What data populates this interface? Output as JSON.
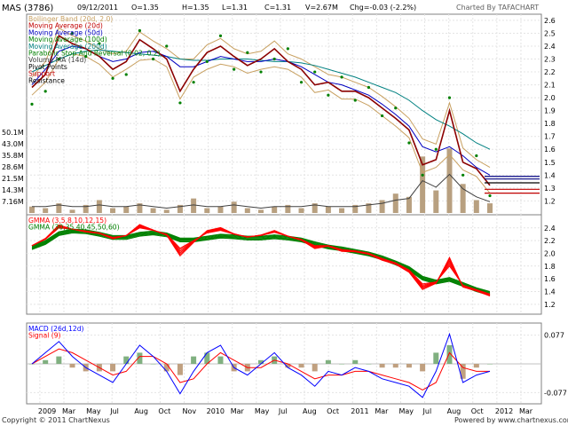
{
  "header": {
    "symbol": "MAS (3786)",
    "date": "09/12/2011",
    "open": "O=1.35",
    "high": "H=1.35",
    "low": "L=1.31",
    "close": "C=1.31",
    "volume": "V=2.67M",
    "change": "Chg=-0.03 (-2.2%)",
    "charted_by": "Charted By TAFACHART"
  },
  "footer": {
    "copyright": "Copyright © 2011 ChartNexus",
    "powered_by": "Powered by www.chartnexus.com"
  },
  "colors": {
    "price": "#8b0000",
    "bollinger": "#c8a060",
    "ma20": "#c00000",
    "ma50": "#0000c0",
    "ma100": "#008000",
    "ma200": "#008080",
    "psar": "#008000",
    "volume": "#b8a080",
    "volume_ma": "#404040",
    "gmma_short": "#ff0000",
    "gmma_long": "#008000",
    "macd": "#0000ff",
    "signal": "#ff0000",
    "hist_pos": "#80b080",
    "hist_neg": "#c0a080"
  },
  "chart_data": [
    {
      "type": "line",
      "title": "MAS (3786)",
      "legend": [
        {
          "label": "Bollinger Band (20d, 2.0)",
          "color": "#c8a060"
        },
        {
          "label": "Moving Average (20d)",
          "color": "#c00000"
        },
        {
          "label": "Moving Average (50d)",
          "color": "#0000c0"
        },
        {
          "label": "Moving Average (100d)",
          "color": "#008000"
        },
        {
          "label": "Moving Average (200d)",
          "color": "#008080"
        },
        {
          "label": "Parabolic Stop And Reversal (0.02, 0.2)",
          "color": "#008000"
        },
        {
          "label": "Volume MA (14d)",
          "color": "#404040"
        },
        {
          "label": "Pivot Points",
          "color": "#000000"
        },
        {
          "label": "Support",
          "color": "#c00000"
        },
        {
          "label": "Resistance",
          "color": "#000000"
        }
      ],
      "legend_position": "top-left",
      "x_labels": [
        "2009",
        "Mar",
        "May",
        "Jul",
        "Aug",
        "Oct",
        "Nov",
        "2010",
        "Mar",
        "May",
        "Jul",
        "Aug",
        "Oct",
        "2011",
        "Mar",
        "May",
        "Jul",
        "Aug",
        "Oct",
        "2012",
        "Mar"
      ],
      "y_ticks": [
        1.2,
        1.3,
        1.4,
        1.5,
        1.6,
        1.7,
        1.8,
        1.9,
        2.0,
        2.1,
        2.2,
        2.3,
        2.4,
        2.5,
        2.6
      ],
      "y_tick_labels": [
        "1.2",
        "1.3",
        "1.4",
        "1.5",
        "1.6",
        "1.7",
        "1.8",
        "1.9",
        "2.0",
        "2.1",
        "2.2",
        "2.3",
        "2.4",
        "2.5",
        "2.6"
      ],
      "ylim": [
        1.12,
        2.62
      ],
      "volume_ticks": [
        7.16,
        14.3,
        21.5,
        28.6,
        35.8,
        43.0,
        50.1
      ],
      "volume_tick_labels": [
        "7.16M",
        "14.3M",
        "21.5M",
        "28.6M",
        "35.8M",
        "43.0M",
        "50.1M"
      ],
      "volume_lim": [
        0,
        55
      ],
      "pivot_levels": [
        1.34,
        1.37,
        1.39,
        1.29,
        1.26
      ],
      "months": [
        1,
        2,
        3,
        4,
        5,
        6,
        7,
        8,
        9,
        10,
        11,
        12,
        13,
        14,
        15,
        16,
        17,
        18,
        19,
        20,
        21,
        22,
        23,
        24,
        25,
        26,
        27,
        28,
        29,
        30,
        31,
        32,
        33,
        34,
        35
      ],
      "price": [
        2.08,
        2.18,
        2.48,
        2.42,
        2.38,
        2.32,
        2.22,
        2.28,
        2.45,
        2.38,
        2.3,
        2.05,
        2.22,
        2.35,
        2.4,
        2.32,
        2.25,
        2.3,
        2.38,
        2.28,
        2.22,
        2.1,
        2.12,
        2.05,
        2.05,
        2.0,
        1.92,
        1.84,
        1.75,
        1.48,
        1.52,
        1.9,
        1.5,
        1.45,
        1.32
      ],
      "ma50": [
        2.1,
        2.22,
        2.36,
        2.4,
        2.38,
        2.32,
        2.28,
        2.3,
        2.35,
        2.36,
        2.32,
        2.24,
        2.24,
        2.28,
        2.32,
        2.3,
        2.28,
        2.28,
        2.3,
        2.28,
        2.24,
        2.18,
        2.12,
        2.1,
        2.06,
        2.02,
        1.95,
        1.87,
        1.78,
        1.62,
        1.58,
        1.62,
        1.55,
        1.46,
        1.4
      ],
      "ma200": [
        2.2,
        2.25,
        2.3,
        2.34,
        2.36,
        2.37,
        2.36,
        2.35,
        2.34,
        2.33,
        2.32,
        2.3,
        2.29,
        2.29,
        2.3,
        2.3,
        2.3,
        2.29,
        2.28,
        2.28,
        2.27,
        2.25,
        2.22,
        2.19,
        2.16,
        2.12,
        2.08,
        2.04,
        1.98,
        1.9,
        1.83,
        1.78,
        1.72,
        1.65,
        1.6
      ],
      "psar": [
        1.95,
        2.05,
        2.3,
        2.5,
        2.32,
        2.42,
        2.15,
        2.18,
        2.52,
        2.3,
        2.4,
        1.96,
        2.12,
        2.28,
        2.48,
        2.22,
        2.35,
        2.2,
        2.3,
        2.38,
        2.12,
        2.2,
        2.02,
        2.16,
        1.98,
        2.08,
        1.86,
        1.92,
        1.65,
        1.4,
        1.6,
        2.0,
        1.4,
        1.55,
        1.24
      ],
      "volume": [
        4,
        3,
        6,
        2,
        5,
        8,
        3,
        4,
        6,
        3,
        2,
        5,
        9,
        3,
        4,
        7,
        3,
        2,
        4,
        5,
        3,
        6,
        4,
        3,
        5,
        6,
        8,
        12,
        10,
        35,
        14,
        40,
        18,
        8,
        6
      ],
      "volume_ma": [
        4,
        4,
        5,
        4,
        4,
        5,
        4,
        4,
        5,
        4,
        3,
        4,
        5,
        4,
        4,
        5,
        4,
        3,
        4,
        4,
        4,
        5,
        4,
        4,
        4,
        5,
        6,
        8,
        9,
        20,
        16,
        24,
        15,
        10,
        7
      ]
    },
    {
      "type": "line",
      "title": "GMMA",
      "legend": [
        {
          "label": "GMMA (3,5,8,10,12,15)",
          "color": "#ff0000"
        },
        {
          "label": "GMMA (30,35,40,45,50,60)",
          "color": "#008000"
        }
      ],
      "y_ticks": [
        1.2,
        1.4,
        1.6,
        1.8,
        2.0,
        2.2,
        2.4
      ],
      "y_tick_labels": [
        "1.2",
        "1.4",
        "1.6",
        "1.8",
        "2.0",
        "2.2",
        "2.4"
      ],
      "ylim": [
        1.1,
        2.55
      ],
      "short": [
        2.12,
        2.22,
        2.4,
        2.38,
        2.35,
        2.32,
        2.25,
        2.28,
        2.4,
        2.36,
        2.3,
        2.08,
        2.2,
        2.32,
        2.36,
        2.3,
        2.26,
        2.28,
        2.33,
        2.27,
        2.22,
        2.12,
        2.12,
        2.06,
        2.04,
        2.0,
        1.92,
        1.85,
        1.74,
        1.52,
        1.55,
        1.8,
        1.5,
        1.43,
        1.36
      ],
      "long": [
        2.12,
        2.2,
        2.34,
        2.38,
        2.37,
        2.33,
        2.28,
        2.28,
        2.33,
        2.35,
        2.32,
        2.24,
        2.24,
        2.27,
        2.3,
        2.29,
        2.27,
        2.27,
        2.29,
        2.27,
        2.24,
        2.18,
        2.13,
        2.1,
        2.06,
        2.02,
        1.96,
        1.88,
        1.79,
        1.64,
        1.58,
        1.62,
        1.54,
        1.46,
        1.4
      ]
    },
    {
      "type": "line",
      "title": "MACD",
      "legend": [
        {
          "label": "MACD (26d,12d)",
          "color": "#0000ff"
        },
        {
          "label": "Signal (9)",
          "color": "#ff0000"
        }
      ],
      "y_ticks": [
        0.077,
        -0.077
      ],
      "y_tick_labels": [
        "0.077",
        "-0.077"
      ],
      "ylim": [
        -0.1,
        0.1
      ],
      "macd": [
        0.0,
        0.03,
        0.06,
        0.02,
        -0.01,
        -0.03,
        -0.05,
        0.0,
        0.05,
        0.02,
        -0.02,
        -0.08,
        -0.02,
        0.03,
        0.05,
        -0.01,
        -0.03,
        0.0,
        0.03,
        -0.01,
        -0.03,
        -0.06,
        -0.02,
        -0.03,
        -0.01,
        -0.02,
        -0.04,
        -0.05,
        -0.06,
        -0.09,
        -0.02,
        0.08,
        -0.05,
        -0.03,
        -0.02
      ],
      "signal": [
        0.0,
        0.02,
        0.04,
        0.03,
        0.01,
        -0.01,
        -0.03,
        -0.02,
        0.02,
        0.02,
        0.0,
        -0.05,
        -0.04,
        0.0,
        0.03,
        0.01,
        -0.01,
        -0.01,
        0.01,
        0.0,
        -0.02,
        -0.04,
        -0.03,
        -0.03,
        -0.02,
        -0.02,
        -0.03,
        -0.04,
        -0.05,
        -0.07,
        -0.05,
        0.03,
        -0.01,
        -0.02,
        -0.02
      ]
    }
  ]
}
